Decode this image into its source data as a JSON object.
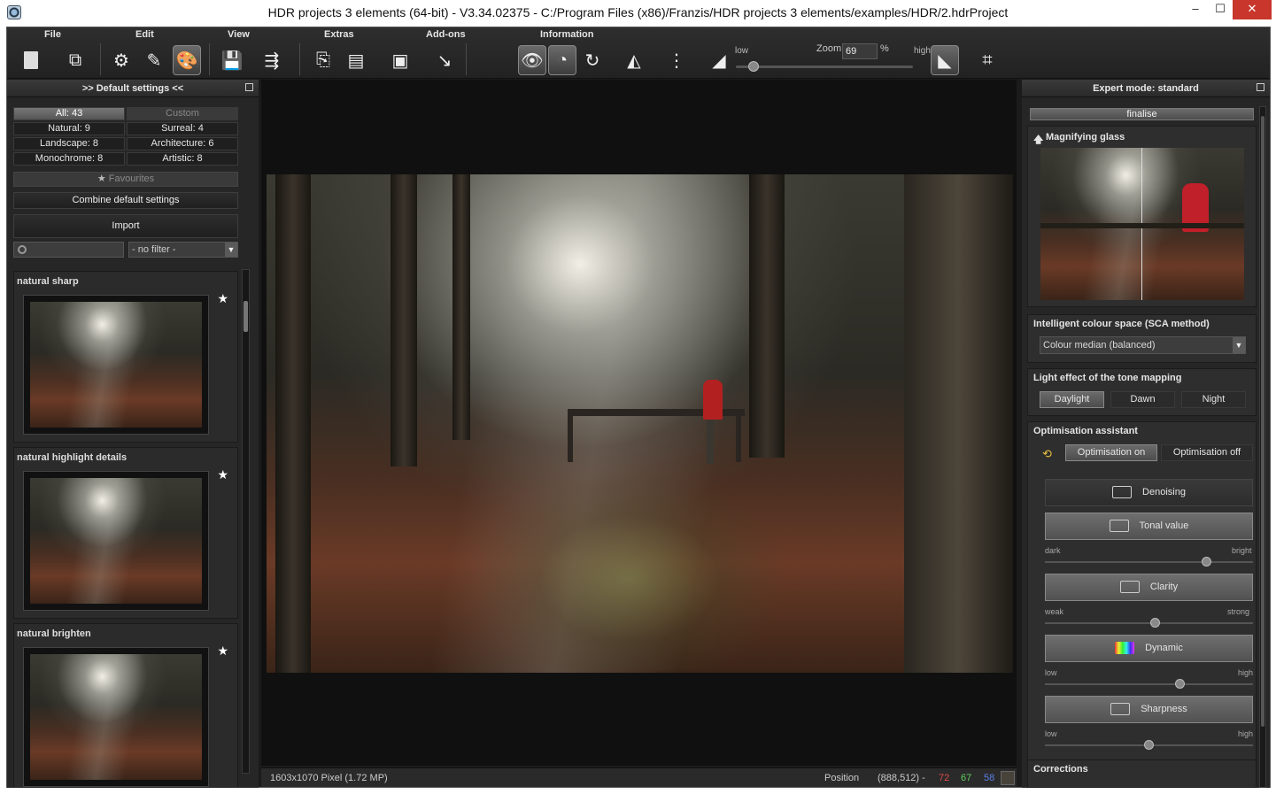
{
  "window": {
    "title": "HDR projects 3 elements (64-bit) - V3.34.02375 - C:/Program Files (x86)/Franzis/HDR projects 3 elements/examples/HDR/2.hdrProject",
    "min": "–",
    "max": "☐",
    "close": "✕"
  },
  "menu": [
    "File",
    "Edit",
    "View",
    "Extras",
    "Add-ons",
    "Information"
  ],
  "zoom": {
    "low_label": "low",
    "high_label": "high",
    "label": "Zoom",
    "value": "69",
    "unit": "%"
  },
  "left_panel": {
    "header": ">> Default settings <<",
    "categories": [
      {
        "label": "All: 43",
        "selected": true
      },
      {
        "label": "Custom",
        "dim": true
      },
      {
        "label": "Natural: 9"
      },
      {
        "label": "Surreal: 4"
      },
      {
        "label": "Landscape: 8"
      },
      {
        "label": "Architecture: 6"
      },
      {
        "label": "Monochrome: 8"
      },
      {
        "label": "Artistic: 8"
      }
    ],
    "favourites": "Favourites",
    "combine": "Combine default settings",
    "import": "Import",
    "search_placeholder": "",
    "filter": "- no filter -",
    "presets": [
      {
        "name": "natural sharp"
      },
      {
        "name": "natural highlight details"
      },
      {
        "name": "natural brighten"
      }
    ]
  },
  "status": {
    "size": "1603x1070 Pixel (1.72 MP)",
    "position_label": "Position",
    "position": "(888,512) -",
    "r": "72",
    "g": "67",
    "b": "58",
    "colors": {
      "r": "#e04a4a",
      "g": "#5fcf5f",
      "b": "#5a7fe8"
    }
  },
  "right_panel": {
    "header": "Expert mode: standard",
    "finalise": "finalise",
    "magnifier_title": "Magnifying glass",
    "sca_title": "Intelligent colour space (SCA method)",
    "sca_value": "Colour median (balanced)",
    "light_title": "Light effect of the tone mapping",
    "light_options": [
      "Daylight",
      "Dawn",
      "Night"
    ],
    "light_selected": "Daylight",
    "opt_title": "Optimisation assistant",
    "opt_on": "Optimisation on",
    "opt_off": "Optimisation off",
    "tools": [
      {
        "label": "Denoising",
        "icon": "denoise-icon"
      },
      {
        "label": "Tonal value",
        "icon": "tonal-value-icon",
        "min": "dark",
        "max": "bright",
        "level": 0.78
      },
      {
        "label": "Clarity",
        "icon": "clarity-icon",
        "min": "weak",
        "max": "strong",
        "level": 0.53
      },
      {
        "label": "Dynamic",
        "icon": "dynamic-icon",
        "min": "low",
        "max": "high",
        "level": 0.65
      },
      {
        "label": "Sharpness",
        "icon": "sharpness-icon",
        "min": "low",
        "max": "high",
        "level": 0.5
      }
    ],
    "corrections_title": "Corrections"
  }
}
